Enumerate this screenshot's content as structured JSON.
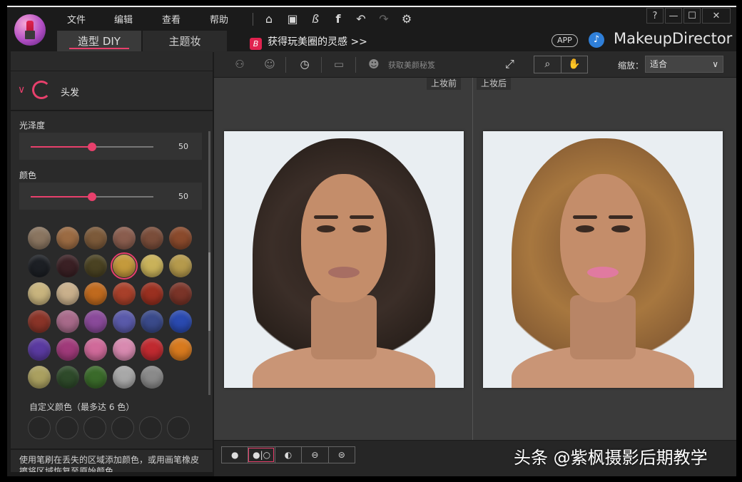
{
  "menu": {
    "file": "文件",
    "edit": "编辑",
    "view": "查看",
    "help": "帮助"
  },
  "window": {
    "help": "?",
    "minimize": "—",
    "maximize": "☐",
    "close": "✕"
  },
  "tabs": {
    "diy": "造型 DIY",
    "theme": "主题妆"
  },
  "promo": {
    "icon_letter": "B",
    "text": "获得玩美圈的灵感 >>"
  },
  "header": {
    "app_badge": "APP",
    "brand": "MakeupDirector"
  },
  "panel": {
    "section": "头发",
    "gloss_label": "光泽度",
    "gloss_value": 50,
    "color_label": "颜色",
    "color_value": 50,
    "custom_label": "自定义颜色（最多达 6 色）",
    "help": "使用笔刷在丢失的区域添加颜色，或用画笔橡皮擦将区域恢复至原始颜色。"
  },
  "swatches": [
    [
      "#8a7560",
      "#9b6b43",
      "#7c5a3a",
      "#8a5d4e",
      "#7a4d3a",
      "#8a4a2c"
    ],
    [
      "#1c1f24",
      "#3a2024",
      "#4a4222",
      "#c49a3c",
      "#c9b25a",
      "#b59a4c"
    ],
    [
      "#c8b47e",
      "#c9b08c",
      "#c06a1e",
      "#a8402a",
      "#9a3020",
      "#7a3428"
    ],
    [
      "#8a3428",
      "#a86a8a",
      "#8a4a9a",
      "#5a5aaa",
      "#3a4a8a",
      "#2a4ab0"
    ],
    [
      "#5a3aa0",
      "#a03a7a",
      "#d06a9a",
      "#d88ab0",
      "#c02a30",
      "#d87a1e"
    ],
    [
      "#aaa060",
      "#2e4a2a",
      "#3a6a2a",
      "#a8a8a8",
      "#8a8a8a"
    ]
  ],
  "selected_swatch": {
    "row": 1,
    "col": 3
  },
  "toolbar": {
    "get_secret": "获取美颜秘笈",
    "zoom_label": "缩放：",
    "zoom_value": "适合"
  },
  "canvas": {
    "before": "上妆前",
    "after": "上妆后"
  },
  "watermark": "头条 @紫枫摄影后期教学"
}
